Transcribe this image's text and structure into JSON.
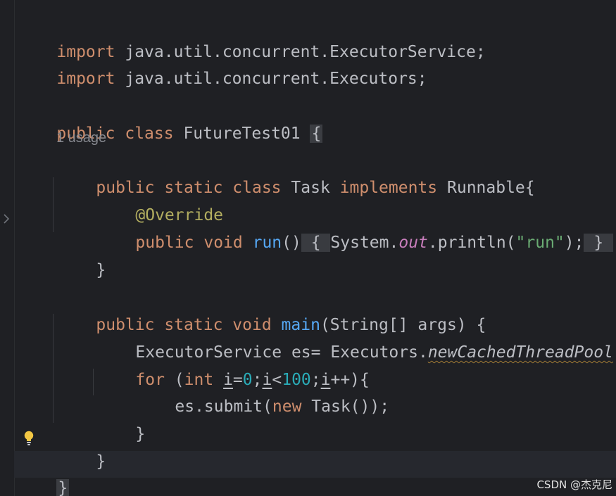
{
  "code": {
    "import_kw": "import",
    "import1_path": "java.util.concurrent.ExecutorService;",
    "import2_path": "java.util.concurrent.Executors;",
    "public_kw": "public",
    "class_kw": "class",
    "static_kw": "static",
    "void_kw": "void",
    "implements_kw": "implements",
    "new_kw": "new",
    "for_kw": "for",
    "int_kw": "int",
    "class_name": "FutureTest01",
    "open_brace": "{",
    "close_brace": "}",
    "usage_hint": "1 usage",
    "task_name": "Task",
    "runnable_name": "Runnable{",
    "override_annotation": "@Override",
    "run_method": "run",
    "run_parens": "()",
    "system_ref": "System.",
    "out_field": "out",
    "println_call": ".println(",
    "run_string": "\"run\"",
    "stmt_end": ");",
    "main_method": "main",
    "main_params": "(String[] args) {",
    "executor_decl": "ExecutorService es= Executors.",
    "new_cached_pool": "newCachedThreadPool",
    "call_end": "();",
    "for_open_paren": "(",
    "loop_var": "i",
    "assign": "=",
    "zero": "0",
    "semicolon": ";",
    "less_than": "<",
    "hundred": "100",
    "increment": "++){",
    "submit_call": "es.submit(",
    "task_call": "Task());"
  },
  "watermark": "CSDN @杰克尼",
  "icons": {
    "fold": "chevron-right-icon",
    "intention": "lightbulb-icon"
  },
  "colors": {
    "background": "#1f2024",
    "keyword": "#cf8e6d",
    "function": "#56a8f5",
    "annotation": "#b3ae60",
    "string": "#6aab73",
    "number": "#2aacb8",
    "static_field": "#c77dbb",
    "text": "#bcbec4",
    "hint": "#86888f"
  }
}
